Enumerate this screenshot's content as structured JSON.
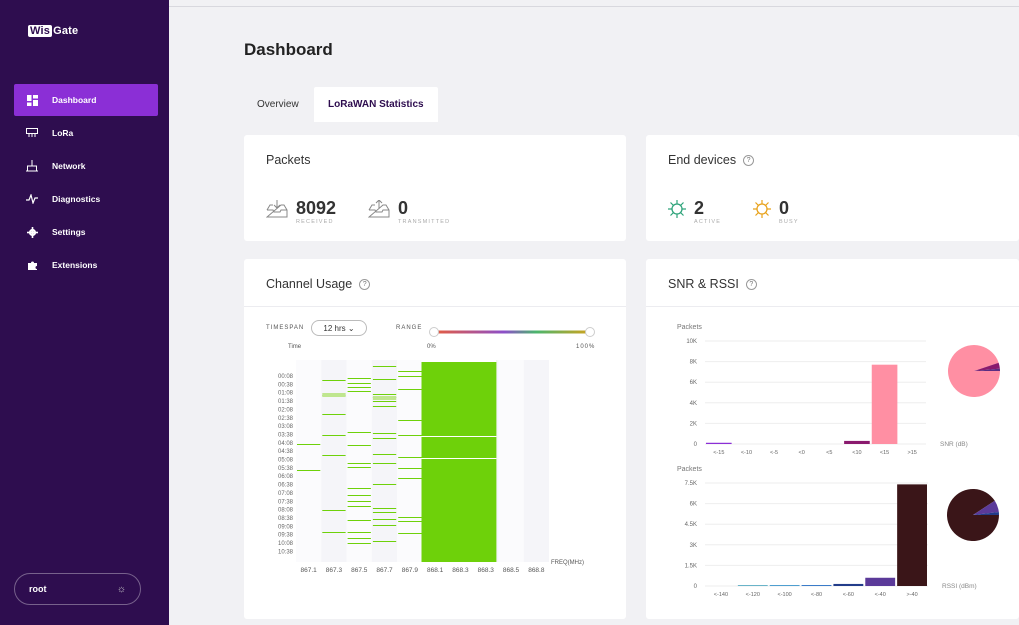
{
  "sidebar": {
    "logo": {
      "wis": "Wis",
      "gate": "Gate"
    },
    "items": [
      {
        "label": "Dashboard",
        "icon": "dashboard-icon",
        "active": true
      },
      {
        "label": "LoRa",
        "icon": "lora-icon",
        "active": false
      },
      {
        "label": "Network",
        "icon": "network-icon",
        "active": false
      },
      {
        "label": "Diagnostics",
        "icon": "diagnostics-icon",
        "active": false
      },
      {
        "label": "Settings",
        "icon": "gear-icon",
        "active": false
      },
      {
        "label": "Extensions",
        "icon": "puzzle-icon",
        "active": false
      }
    ],
    "user": "root"
  },
  "header": {
    "title": "Dashboard",
    "tabs": [
      {
        "label": "Overview",
        "active": false
      },
      {
        "label": "LoRaWAN Statistics",
        "active": true
      }
    ]
  },
  "packets": {
    "title": "Packets",
    "received": {
      "value": "8092",
      "label": "RECEIVED"
    },
    "transmitted": {
      "value": "0",
      "label": "TRANSMITTED"
    }
  },
  "end_devices": {
    "title": "End devices",
    "active": {
      "value": "2",
      "label": "ACTIVE"
    },
    "busy": {
      "value": "0",
      "label": "BUSY"
    }
  },
  "channel_usage": {
    "title": "Channel Usage",
    "timespan_label": "TIMESPAN",
    "timespan_value": "12 hrs ⌄",
    "range_label": "RANGE",
    "range_min": "0%",
    "range_max": "100%",
    "time_label": "Time",
    "freq_label": "FREQ(MHz)",
    "times": [
      "00:08",
      "00:38",
      "01:08",
      "01:38",
      "02:08",
      "02:38",
      "03:08",
      "03:38",
      "04:08",
      "04:38",
      "05:08",
      "05:38",
      "06:08",
      "06:38",
      "07:08",
      "07:38",
      "08:08",
      "08:38",
      "09:08",
      "09:38",
      "10:08",
      "10:38"
    ],
    "channels": [
      "867.1",
      "867.3",
      "867.5",
      "867.7",
      "867.9",
      "868.1",
      "868.3",
      "868.3",
      "868.5",
      "868.8"
    ]
  },
  "snr_rssi": {
    "title": "SNR & RSSI",
    "snr": {
      "ylabel": "Packets",
      "xlabel": "SNR (dB)",
      "yticks": [
        "10K",
        "8K",
        "6K",
        "4K",
        "2K",
        "0"
      ],
      "categories": [
        "<-15",
        "<-10",
        "<-5",
        "<0",
        "<5",
        "<10",
        "<15",
        ">15"
      ],
      "values": [
        120,
        0,
        0,
        0,
        0,
        300,
        7700,
        0
      ],
      "pie": [
        {
          "value": 7700,
          "color": "#ff8fa3"
        },
        {
          "value": 300,
          "color": "#8a1a6e"
        },
        {
          "value": 120,
          "color": "#5a2d82"
        }
      ]
    },
    "rssi": {
      "ylabel": "Packets",
      "xlabel": "RSSI (dBm)",
      "yticks": [
        "7.5K",
        "6K",
        "4.5K",
        "3K",
        "1.5K",
        "0"
      ],
      "categories": [
        "<-140",
        "<-120",
        "<-100",
        "<-80",
        "<-60",
        "<-40",
        ">-40"
      ],
      "values": [
        0,
        30,
        60,
        40,
        150,
        600,
        7400
      ],
      "pie": [
        {
          "value": 7400,
          "color": "#3a1518"
        },
        {
          "value": 600,
          "color": "#5b3a99"
        },
        {
          "value": 150,
          "color": "#223c8a"
        }
      ]
    }
  },
  "colors": {
    "sidebar_bg": "#2e0d4f",
    "active_item": "#8b2fd6",
    "channel_green": "#6ed10a",
    "icon_green": "#2ea37a",
    "icon_orange": "#e8a21b"
  }
}
